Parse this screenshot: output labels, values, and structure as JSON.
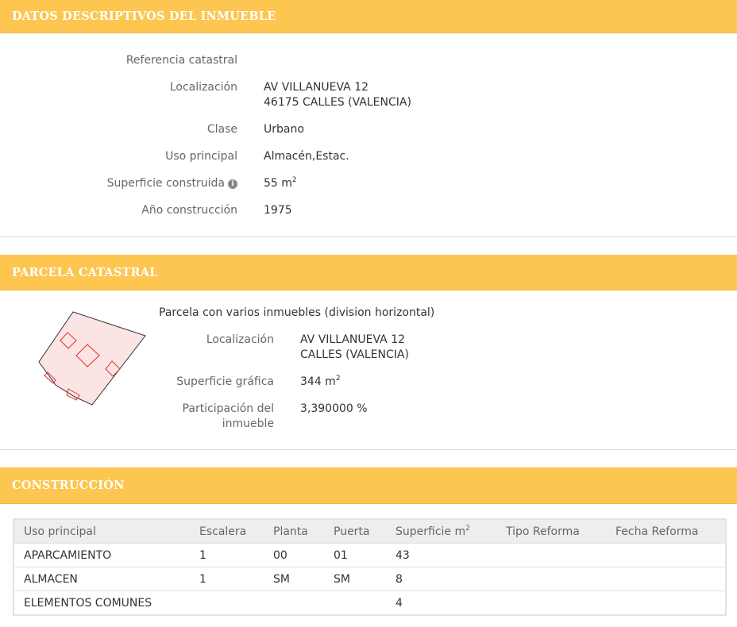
{
  "datos": {
    "header": "DATOS DESCRIPTIVOS DEL INMUEBLE",
    "referencia_label": "Referencia catastral",
    "referencia_value": "",
    "localizacion_label": "Localización",
    "localizacion_line1": "AV VILLANUEVA 12",
    "localizacion_line2": "46175 CALLES (VALENCIA)",
    "clase_label": "Clase",
    "clase_value": "Urbano",
    "uso_label": "Uso principal",
    "uso_value": "Almacén,Estac.",
    "superficie_label": "Superficie construida",
    "superficie_value": "55 m",
    "superficie_sup": "2",
    "info_icon": "info-icon",
    "anio_label": "Año construcción",
    "anio_value": "1975"
  },
  "parcela": {
    "header": "PARCELA CATASTRAL",
    "description": "Parcela con varios inmuebles (division horizontal)",
    "localizacion_label": "Localización",
    "localizacion_line1": "AV VILLANUEVA 12",
    "localizacion_line2": "CALLES (VALENCIA)",
    "superficie_label": "Superficie gráfica",
    "superficie_value": "344 m",
    "superficie_sup": "2",
    "participacion_label_1": "Participación del",
    "participacion_label_2": "inmueble",
    "participacion_value": "3,390000 %",
    "map_fill": "#fde4e4",
    "map_outline": "#333333",
    "map_units": "#e03030"
  },
  "construccion": {
    "header": "CONSTRUCCIÓN",
    "columns": [
      "Uso principal",
      "Escalera",
      "Planta",
      "Puerta",
      "Superficie m",
      "Tipo Reforma",
      "Fecha Reforma"
    ],
    "superficie_sup": "2",
    "rows": [
      [
        "APARCAMIENTO",
        "1",
        "00",
        "01",
        "43",
        "",
        ""
      ],
      [
        "ALMACEN",
        "1",
        "SM",
        "SM",
        "8",
        "",
        ""
      ],
      [
        "ELEMENTOS COMUNES",
        "",
        "",
        "",
        "4",
        "",
        ""
      ]
    ]
  },
  "colors": {
    "header_bg": "#fcc650",
    "header_text": "#ffffff",
    "table_header_bg": "#eeeeee"
  }
}
